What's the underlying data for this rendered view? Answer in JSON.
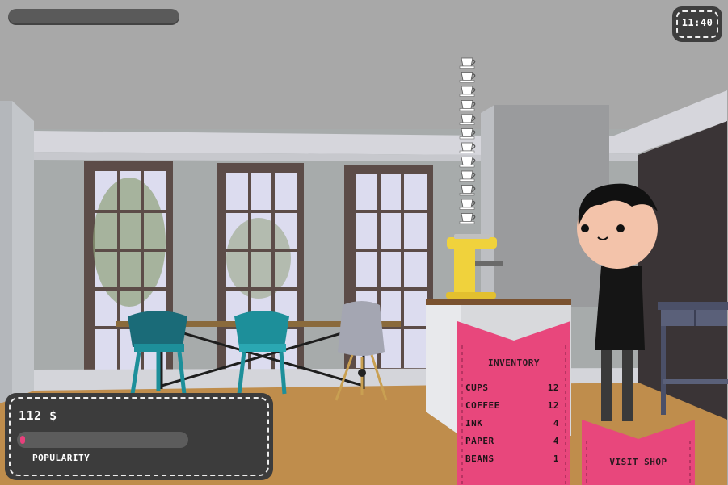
{
  "hud": {
    "clock": "11:40",
    "money": "112 $",
    "popularity_label": "POPULARITY",
    "popularity_level": 0.03
  },
  "inventory": {
    "title": "INVENTORY",
    "items": [
      {
        "name": "CUPS",
        "count": "12"
      },
      {
        "name": "COFFEE",
        "count": "12"
      },
      {
        "name": "INK",
        "count": "4"
      },
      {
        "name": "PAPER",
        "count": "4"
      },
      {
        "name": "BEANS",
        "count": "1"
      }
    ]
  },
  "shop": {
    "label": "VISIT SHOP"
  },
  "cup_stack": {
    "count": 12
  },
  "colors": {
    "banner_pink": "#e8477c",
    "panel_dark": "#3c3c3c",
    "espresso_yellow": "#f0d23c",
    "chair_teal": "#1d8f9a"
  },
  "icons": {
    "cup": "coffee-cup-icon"
  }
}
